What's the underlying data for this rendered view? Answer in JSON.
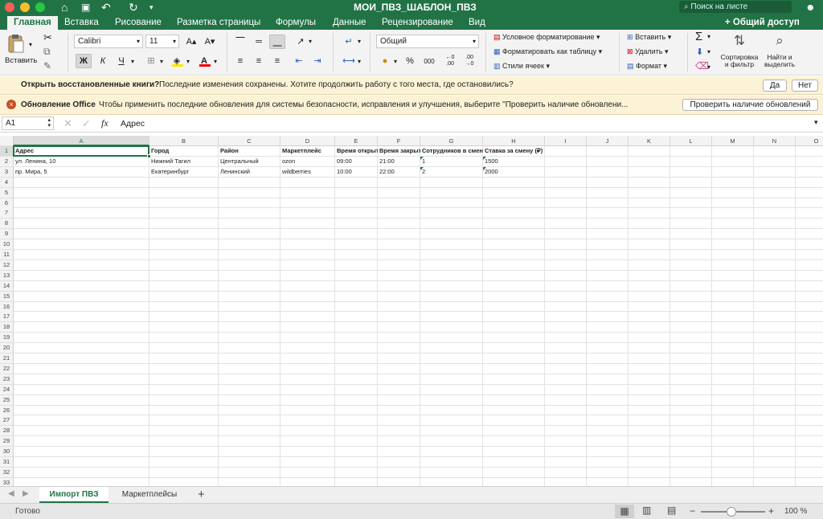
{
  "titlebar": {
    "title": "МОИ_ПВЗ_ШАБЛОН_ПВЗ",
    "search_placeholder": "Поиск на листе"
  },
  "tabs": [
    "Главная",
    "Вставка",
    "Рисование",
    "Разметка страницы",
    "Формулы",
    "Данные",
    "Рецензирование",
    "Вид"
  ],
  "share": "Общий доступ",
  "ribbon": {
    "paste": "Вставить",
    "font_name": "Calibri",
    "font_size": "11",
    "bold": "Ж",
    "italic": "К",
    "underline": "Ч",
    "number_format": "Общий",
    "percent": "%",
    "thousands": "000",
    "cond_format": "Условное форматирование",
    "format_table": "Форматировать как таблицу",
    "cell_styles": "Стили ячеек",
    "insert": "Вставить",
    "delete": "Удалить",
    "format": "Формат",
    "sort_filter": "Сортировка\nи фильтр",
    "find_select": "Найти и\nвыделить"
  },
  "notifications": {
    "recovered": {
      "title": "Открыть восстановленные книги?",
      "text": "Последние изменения сохранены. Хотите продолжить работу с того места, где остановились?",
      "yes": "Да",
      "no": "Нет"
    },
    "update": {
      "title": "Обновление Office",
      "text": "Чтобы применить последние обновления для системы безопасности, исправления и улучшения, выберите \"Проверить наличие обновлени...",
      "button": "Проверить наличие обновлений"
    }
  },
  "formula_bar": {
    "name_box": "A1",
    "fx": "fx",
    "content": "Адрес"
  },
  "columns": [
    "A",
    "B",
    "C",
    "D",
    "E",
    "F",
    "G",
    "H",
    "I",
    "J",
    "K",
    "L",
    "M",
    "N",
    "O"
  ],
  "rows": [
    "1",
    "2",
    "3",
    "4",
    "5",
    "6",
    "7",
    "8",
    "9",
    "10",
    "11",
    "12",
    "13",
    "14",
    "15",
    "16",
    "17",
    "18",
    "19",
    "20",
    "21",
    "22",
    "23",
    "24",
    "25",
    "26",
    "27",
    "28",
    "29",
    "30",
    "31",
    "32",
    "33"
  ],
  "sheet": {
    "header": [
      "Адрес",
      "Город",
      "Район",
      "Маркетплейс",
      "Время открытия",
      "Время закрытия",
      "Сотрудников в смене",
      "Ставка за смену (₽)"
    ],
    "data": [
      [
        "ул. Ленина, 10",
        "Нижний Тагил",
        "Центральный",
        "ozon",
        "09:00",
        "21:00",
        "1",
        "1500"
      ],
      [
        "пр. Мира, 5",
        "Екатеринбург",
        "Ленинский",
        "wildberries",
        "10:00",
        "22:00",
        "2",
        "2000"
      ]
    ]
  },
  "sheet_tabs": [
    "Импорт ПВЗ",
    "Маркетплейсы"
  ],
  "status": {
    "ready": "Готово",
    "zoom": "100 %"
  }
}
